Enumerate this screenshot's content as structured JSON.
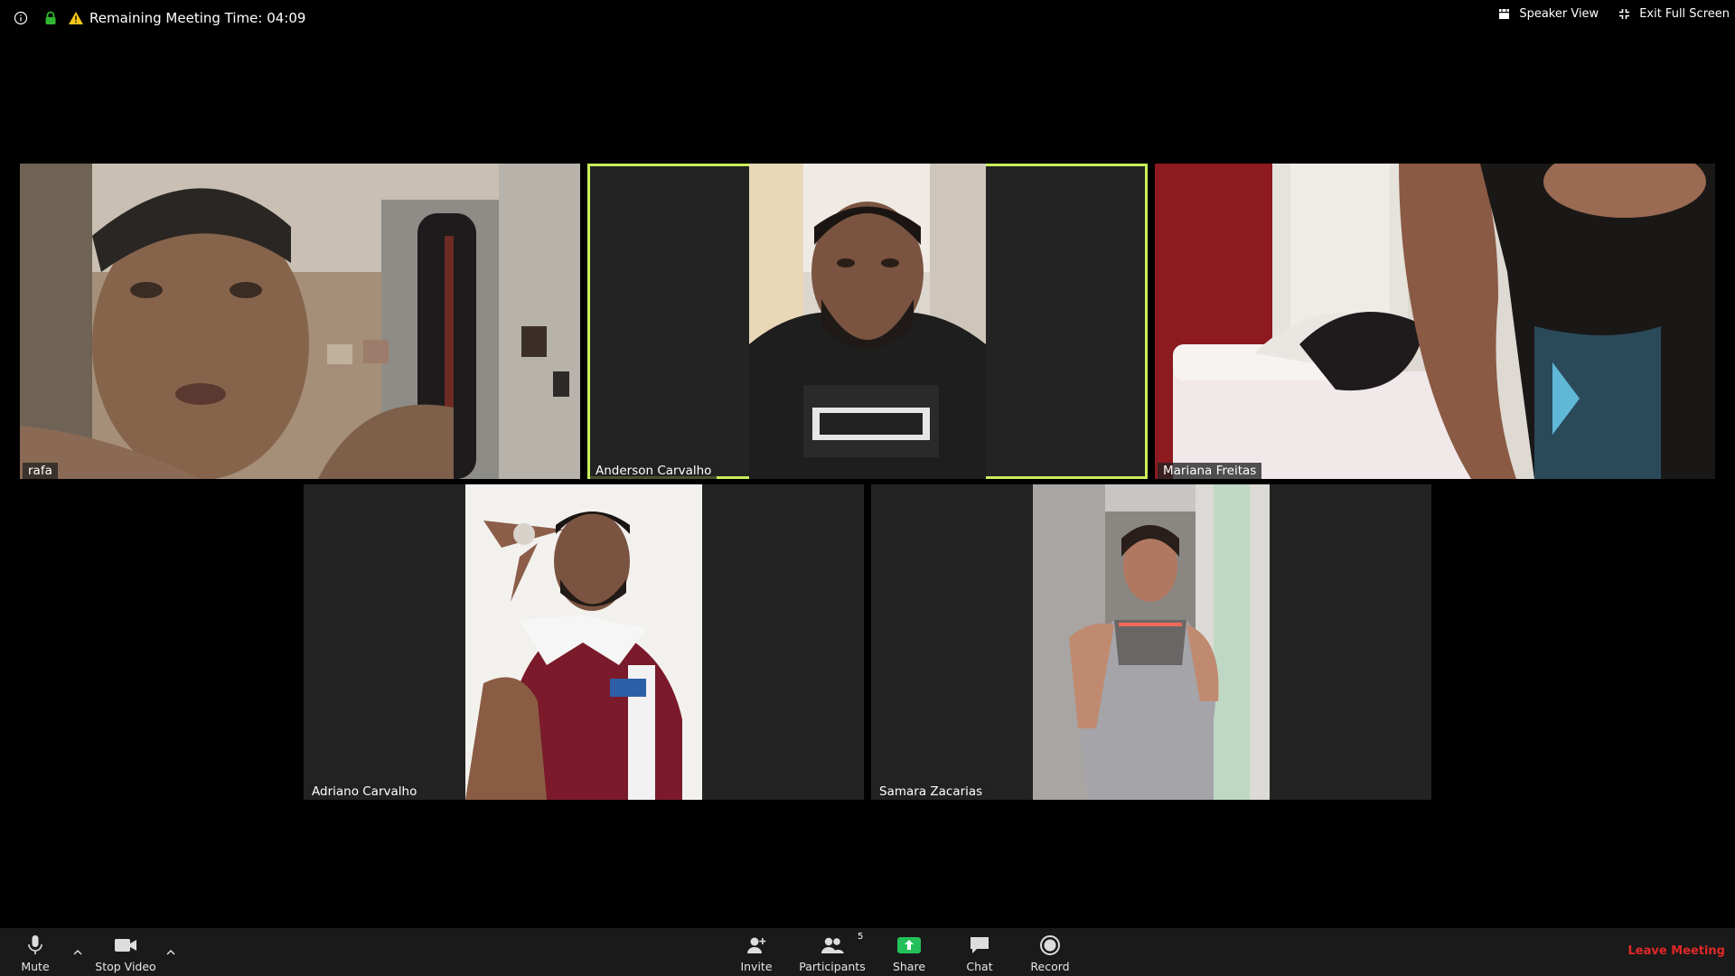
{
  "topbar": {
    "meeting_time_text": "Remaining Meeting Time: 04:09",
    "speaker_view_label": "Speaker View",
    "exit_fullscreen_label": "Exit Full Screen"
  },
  "participants": [
    {
      "name": "rafa",
      "active_speaker": false
    },
    {
      "name": "Anderson Carvalho",
      "active_speaker": true
    },
    {
      "name": "Mariana Freitas",
      "active_speaker": false
    },
    {
      "name": "Adriano Carvalho",
      "active_speaker": false
    },
    {
      "name": "Samara Zacarias",
      "active_speaker": false
    }
  ],
  "toolbar": {
    "mute_label": "Mute",
    "stop_video_label": "Stop Video",
    "invite_label": "Invite",
    "participants_label": "Participants",
    "participants_count": "5",
    "share_label": "Share",
    "chat_label": "Chat",
    "record_label": "Record",
    "leave_label": "Leave Meeting"
  },
  "colors": {
    "active_speaker_border": "#c8f05a",
    "share_green": "#23c05a",
    "leave_red": "#e02828",
    "lock_green": "#2fb52f",
    "warning_yellow": "#f5c518"
  },
  "icons": [
    "info-icon",
    "lock-icon",
    "warning-icon",
    "speaker-view-icon",
    "exit-fullscreen-icon",
    "microphone-icon",
    "video-camera-icon",
    "add-person-icon",
    "participants-icon",
    "share-arrow-icon",
    "chat-bubble-icon",
    "record-icon",
    "chevron-up-icon"
  ]
}
